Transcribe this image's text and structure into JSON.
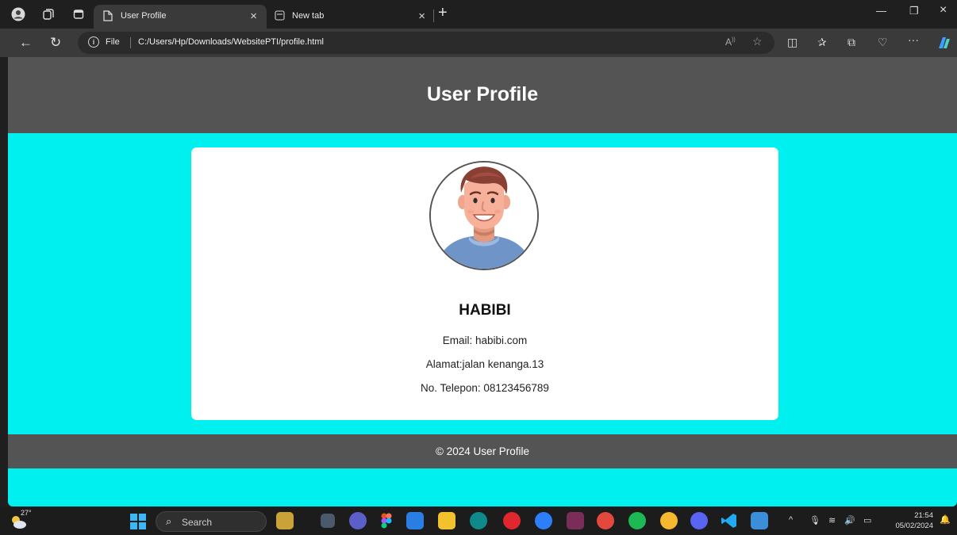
{
  "browser": {
    "tabs": [
      {
        "label": "User Profile",
        "active": true
      },
      {
        "label": "New tab",
        "active": false
      }
    ],
    "address": {
      "scheme_label": "File",
      "url": "C:/Users/Hp/Downloads/WebsitePTI/profile.html"
    },
    "toolbar_icons": [
      "read-aloud-icon",
      "favorite-star-icon",
      "split-screen-icon",
      "favorites-icon",
      "collections-icon",
      "browser-essentials-icon",
      "more-icon",
      "copilot-icon"
    ]
  },
  "page": {
    "header_title": "User Profile",
    "profile": {
      "name": "HABIBI",
      "email": "Email: habibi.com",
      "address": "Alamat:jalan kenanga.13",
      "phone": "No. Telepon: 08123456789"
    },
    "footer_text": "© 2024 User Profile"
  },
  "colors": {
    "page_background": "#00f0f0",
    "header_footer": "#545454",
    "card": "#ffffff"
  },
  "taskbar": {
    "weather_temp": "27°",
    "search_label": "Search",
    "time": "21:54",
    "date": "05/02/2024"
  }
}
